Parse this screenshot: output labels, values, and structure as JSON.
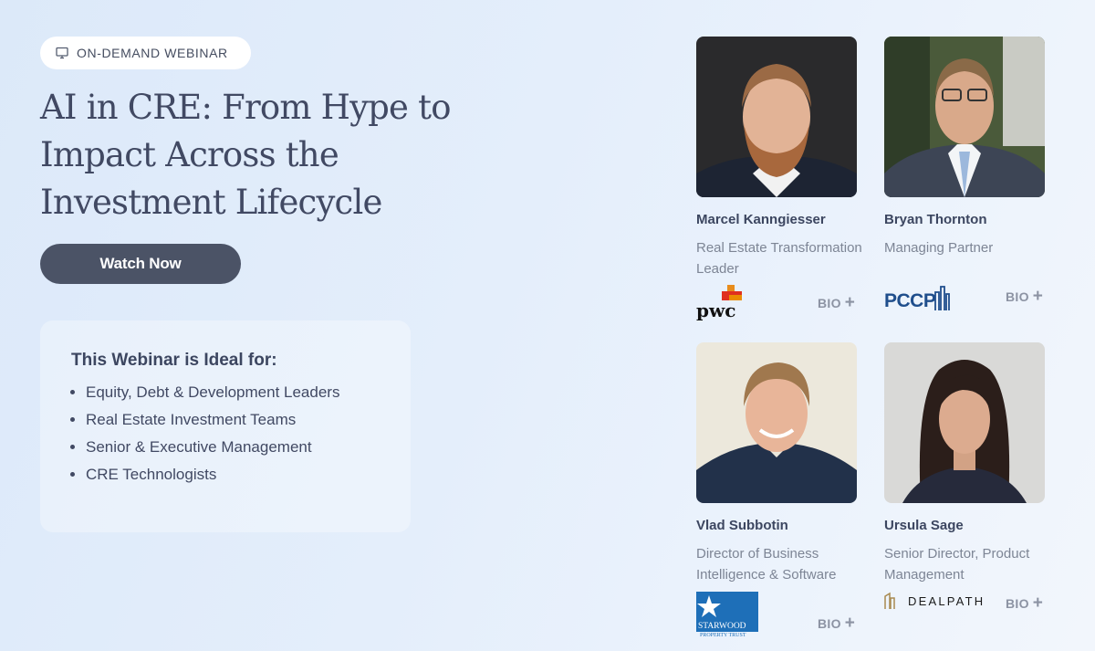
{
  "badge": {
    "label": "ON-DEMAND WEBINAR",
    "icon": "monitor-icon"
  },
  "hero": {
    "title_lines": [
      "AI in CRE: From Hype to",
      "Impact Across the",
      "Investment Lifecycle"
    ],
    "cta_label": "Watch Now"
  },
  "ideal": {
    "heading": "This Webinar is Ideal for:",
    "items": [
      "Equity, Debt & Development Leaders",
      "Real Estate Investment Teams",
      "Senior & Executive Management",
      "CRE Technologists"
    ]
  },
  "speakers": [
    {
      "name": "Marcel Kanngiesser",
      "role": "Real Estate Transformation Leader",
      "company_logo": "pwc",
      "bio_label": "BIO"
    },
    {
      "name": "Bryan Thornton",
      "role": "Managing Partner",
      "company_logo": "PCCP",
      "bio_label": "BIO"
    },
    {
      "name": "Vlad Subbotin",
      "role": "Director of Business Intelligence & Software",
      "company_logo": "STARWOOD PROPERTY TRUST",
      "bio_label": "BIO"
    },
    {
      "name": "Ursula Sage",
      "role": "Senior Director, Product Management",
      "company_logo": "DEALPATH",
      "bio_label": "BIO"
    }
  ],
  "colors": {
    "background": "#e4eefb",
    "button": "#4b5366",
    "heading": "#414963",
    "muted": "#7d8595",
    "pwc_orange": "#e0301e",
    "pccp_blue": "#1f4e8c",
    "starwood_blue": "#1e6fb8"
  }
}
